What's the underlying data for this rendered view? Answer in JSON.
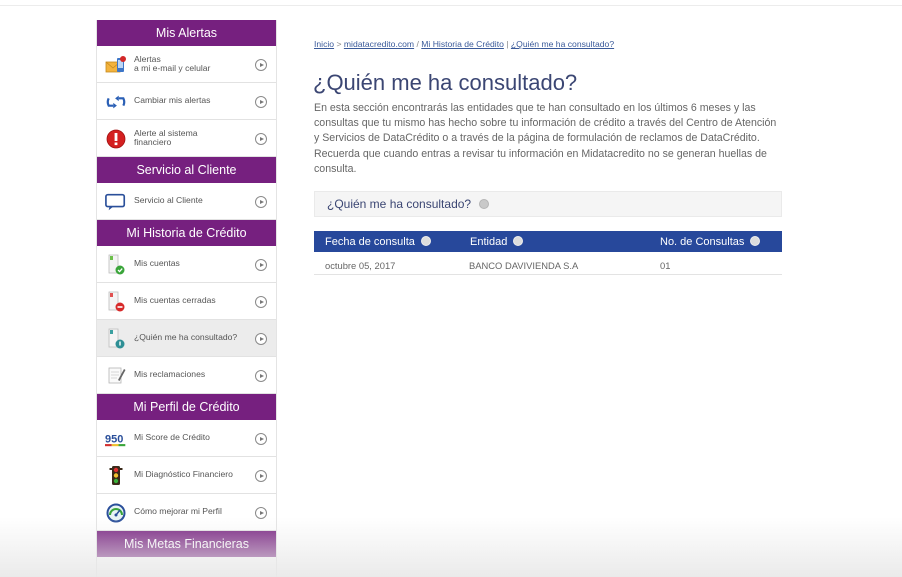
{
  "sidebar": {
    "sections": [
      {
        "title": "Mis Alertas",
        "items": [
          {
            "lines": [
              "Alertas",
              "a mi e-mail y celular"
            ],
            "icon": "email-phone-alert-icon"
          },
          {
            "lines": [
              "Cambiar mis alertas"
            ],
            "icon": "change-arrows-icon"
          },
          {
            "lines": [
              "Alerte al sistema",
              "financiero"
            ],
            "icon": "exclamation-icon"
          }
        ]
      },
      {
        "title": "Servicio al Cliente",
        "items": [
          {
            "lines": [
              "Servicio al Cliente"
            ],
            "icon": "chat-bubble-icon"
          }
        ]
      },
      {
        "title": "Mi Historia de Crédito",
        "items": [
          {
            "lines": [
              "Mis cuentas"
            ],
            "icon": "accounts-check-icon"
          },
          {
            "lines": [
              "Mis cuentas cerradas"
            ],
            "icon": "accounts-closed-icon"
          },
          {
            "lines": [
              "¿Quién me ha consultado?"
            ],
            "icon": "accounts-consult-icon",
            "active": true
          },
          {
            "lines": [
              "Mis reclamaciones"
            ],
            "icon": "notepad-icon"
          }
        ]
      },
      {
        "title": "Mi Perfil de Crédito",
        "items": [
          {
            "lines": [
              "Mi Score de Crédito"
            ],
            "icon": "score-950-icon",
            "icon_text": "950"
          },
          {
            "lines": [
              "Mi Diagnóstico Financiero"
            ],
            "icon": "traffic-light-icon"
          },
          {
            "lines": [
              "Cómo mejorar mi Perfil"
            ],
            "icon": "gauge-icon"
          }
        ]
      },
      {
        "title": "Mis Metas Financieras",
        "items": []
      }
    ]
  },
  "breadcrumb": {
    "home": "Inicio",
    "site": "midatacredito.com",
    "history": "Mi Historia de Crédito",
    "current": "¿Quién me ha consultado?",
    "sep1": ">",
    "sep2": "/",
    "sep3": "|"
  },
  "page": {
    "title": "¿Quién me ha consultado?",
    "intro": "En esta sección encontrarás las entidades que te han consultado en los últimos 6 meses y las consultas que tu mismo has hecho sobre tu información de crédito a través del Centro de Atención y Servicios de DataCrédito o a través de la página de formulación de reclamos de DataCrédito. Recuerda que cuando entras a revisar tu información en Midatacredito no se generan huellas de consulta."
  },
  "panel": {
    "title": "¿Quién me ha consultado?"
  },
  "table": {
    "headers": [
      "Fecha de consulta",
      "Entidad",
      "No. de Consultas"
    ],
    "rows": [
      [
        "octubre 05, 2017",
        "BANCO DAVIVIENDA S.A",
        "01"
      ]
    ]
  },
  "colors": {
    "sidebar_header": "#76207f",
    "table_header": "#27489b",
    "title": "#3b4673"
  }
}
